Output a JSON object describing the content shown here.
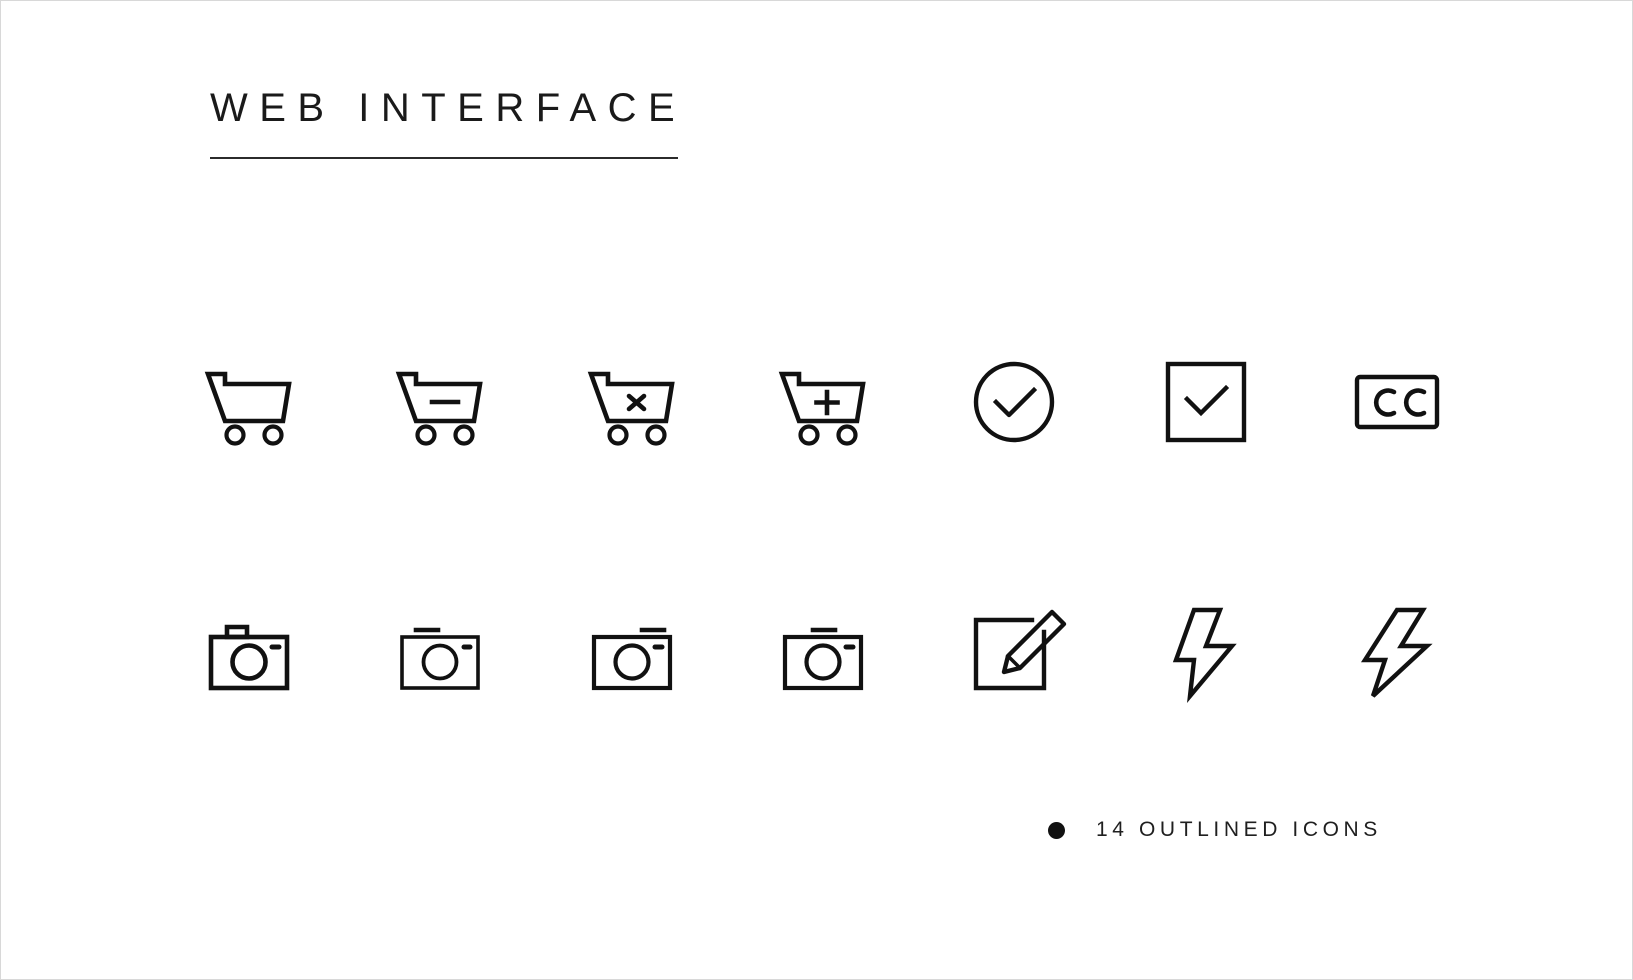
{
  "page": {
    "background_color": "#ffffff",
    "border_color": "#d8d8d8",
    "stroke_color": "#111111"
  },
  "header": {
    "title": "WEB INTERFACE"
  },
  "footer": {
    "bullet": "●",
    "caption": "14 OUTLINED ICONS",
    "count": 14
  },
  "icons": {
    "rows": [
      {
        "items": [
          {
            "name": "shopping-cart-icon",
            "label": "Shopping cart"
          },
          {
            "name": "cart-remove-icon",
            "label": "Remove from cart"
          },
          {
            "name": "cart-delete-icon",
            "label": "Delete from cart"
          },
          {
            "name": "cart-add-icon",
            "label": "Add to cart"
          },
          {
            "name": "check-circle-icon",
            "label": "Check circle"
          },
          {
            "name": "check-square-icon",
            "label": "Check square"
          },
          {
            "name": "closed-caption-icon",
            "label": "Closed caption"
          }
        ]
      },
      {
        "items": [
          {
            "name": "camera-icon",
            "label": "Camera"
          },
          {
            "name": "camera-flat-icon",
            "label": "Camera flat top"
          },
          {
            "name": "camera-right-icon",
            "label": "Camera right marker"
          },
          {
            "name": "camera-center-icon",
            "label": "Camera center marker"
          },
          {
            "name": "edit-pencil-icon",
            "label": "Edit"
          },
          {
            "name": "flash-bolt-icon",
            "label": "Flash"
          },
          {
            "name": "flash-bolt-italic-icon",
            "label": "Flash italic"
          }
        ]
      }
    ]
  }
}
